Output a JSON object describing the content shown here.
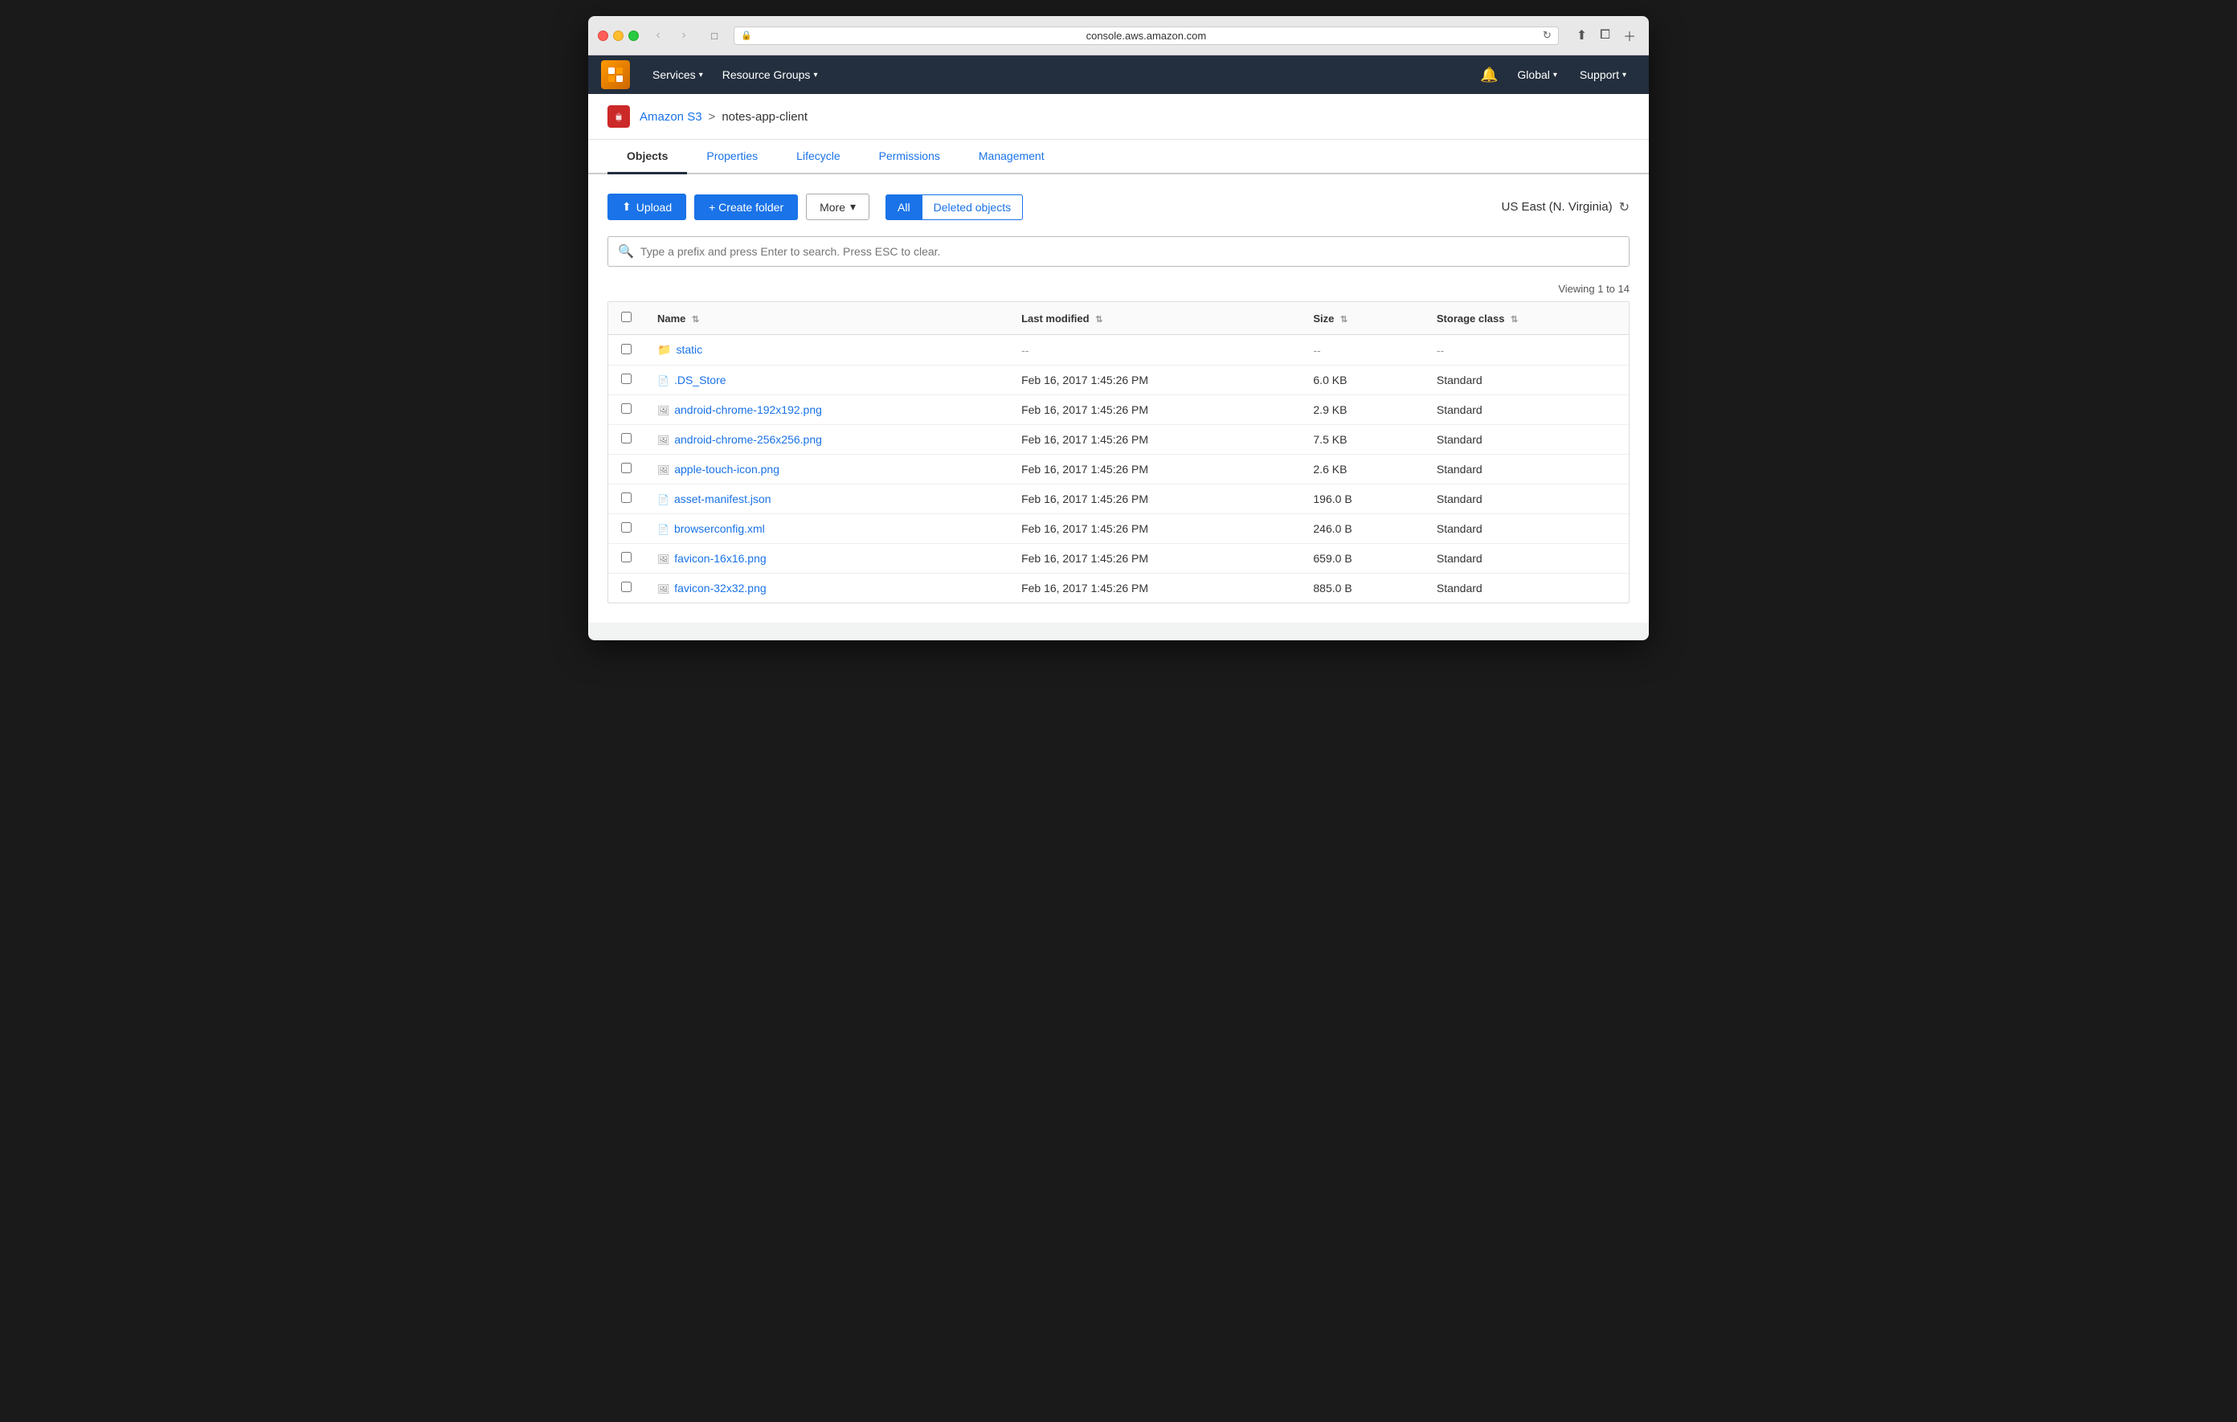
{
  "browser": {
    "url": "console.aws.amazon.com",
    "back_disabled": true,
    "forward_disabled": true
  },
  "aws_nav": {
    "services_label": "Services",
    "resource_groups_label": "Resource Groups",
    "global_label": "Global",
    "support_label": "Support"
  },
  "breadcrumb": {
    "s3_link": "Amazon S3",
    "separator": ">",
    "bucket_name": "notes-app-client"
  },
  "tabs": [
    {
      "id": "objects",
      "label": "Objects",
      "active": true
    },
    {
      "id": "properties",
      "label": "Properties",
      "active": false
    },
    {
      "id": "lifecycle",
      "label": "Lifecycle",
      "active": false
    },
    {
      "id": "permissions",
      "label": "Permissions",
      "active": false
    },
    {
      "id": "management",
      "label": "Management",
      "active": false
    }
  ],
  "toolbar": {
    "upload_label": "Upload",
    "create_folder_label": "+ Create folder",
    "more_label": "More",
    "all_label": "All",
    "deleted_objects_label": "Deleted objects",
    "region_label": "US East (N. Virginia)"
  },
  "search": {
    "placeholder": "Type a prefix and press Enter to search. Press ESC to clear."
  },
  "table": {
    "viewing_text": "Viewing 1 to 14",
    "columns": [
      {
        "id": "name",
        "label": "Name"
      },
      {
        "id": "last_modified",
        "label": "Last modified"
      },
      {
        "id": "size",
        "label": "Size"
      },
      {
        "id": "storage_class",
        "label": "Storage class"
      }
    ],
    "rows": [
      {
        "name": "static",
        "type": "folder",
        "last_modified": "--",
        "size": "--",
        "storage_class": "--"
      },
      {
        "name": ".DS_Store",
        "type": "file",
        "last_modified": "Feb 16, 2017 1:45:26 PM",
        "size": "6.0 KB",
        "storage_class": "Standard"
      },
      {
        "name": "android-chrome-192x192.png",
        "type": "image",
        "last_modified": "Feb 16, 2017 1:45:26 PM",
        "size": "2.9 KB",
        "storage_class": "Standard"
      },
      {
        "name": "android-chrome-256x256.png",
        "type": "image",
        "last_modified": "Feb 16, 2017 1:45:26 PM",
        "size": "7.5 KB",
        "storage_class": "Standard"
      },
      {
        "name": "apple-touch-icon.png",
        "type": "image",
        "last_modified": "Feb 16, 2017 1:45:26 PM",
        "size": "2.6 KB",
        "storage_class": "Standard"
      },
      {
        "name": "asset-manifest.json",
        "type": "file",
        "last_modified": "Feb 16, 2017 1:45:26 PM",
        "size": "196.0 B",
        "storage_class": "Standard"
      },
      {
        "name": "browserconfig.xml",
        "type": "xml",
        "last_modified": "Feb 16, 2017 1:45:26 PM",
        "size": "246.0 B",
        "storage_class": "Standard"
      },
      {
        "name": "favicon-16x16.png",
        "type": "image",
        "last_modified": "Feb 16, 2017 1:45:26 PM",
        "size": "659.0 B",
        "storage_class": "Standard"
      },
      {
        "name": "favicon-32x32.png",
        "type": "image",
        "last_modified": "Feb 16, 2017 1:45:26 PM",
        "size": "885.0 B",
        "storage_class": "Standard"
      }
    ]
  }
}
